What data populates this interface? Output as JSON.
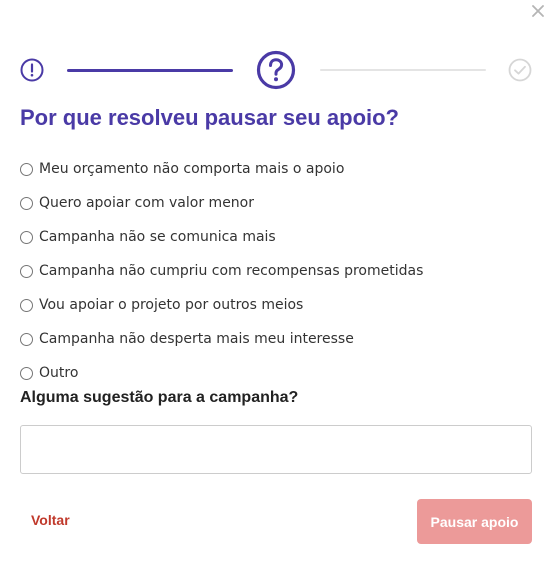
{
  "modal": {
    "close_icon": "close-icon"
  },
  "stepper": {
    "steps": [
      {
        "icon": "exclamation-circle-icon",
        "state": "completed"
      },
      {
        "icon": "question-circle-icon",
        "state": "current"
      },
      {
        "icon": "check-circle-icon",
        "state": "upcoming"
      }
    ],
    "colors": {
      "active": "#4a3aa6",
      "inactive": "#e4e4e4"
    }
  },
  "question": {
    "title": "Por que resolveu pausar seu apoio?",
    "options": [
      {
        "label": "Meu orçamento não comporta mais o apoio",
        "selected": false
      },
      {
        "label": "Quero apoiar com valor menor",
        "selected": false
      },
      {
        "label": "Campanha não se comunica mais",
        "selected": false
      },
      {
        "label": "Campanha não cumpriu com recompensas prometidas",
        "selected": false
      },
      {
        "label": "Vou apoiar o projeto por outros meios",
        "selected": false
      },
      {
        "label": "Campanha não desperta mais meu interesse",
        "selected": false
      },
      {
        "label": "Outro",
        "selected": false
      }
    ]
  },
  "suggestion": {
    "label": "Alguma sugestão para a campanha?",
    "value": "",
    "placeholder": ""
  },
  "actions": {
    "back_label": "Voltar",
    "pause_label": "Pausar apoio",
    "colors": {
      "back": "#c0392b",
      "pause_bg": "#ec9a99"
    }
  }
}
